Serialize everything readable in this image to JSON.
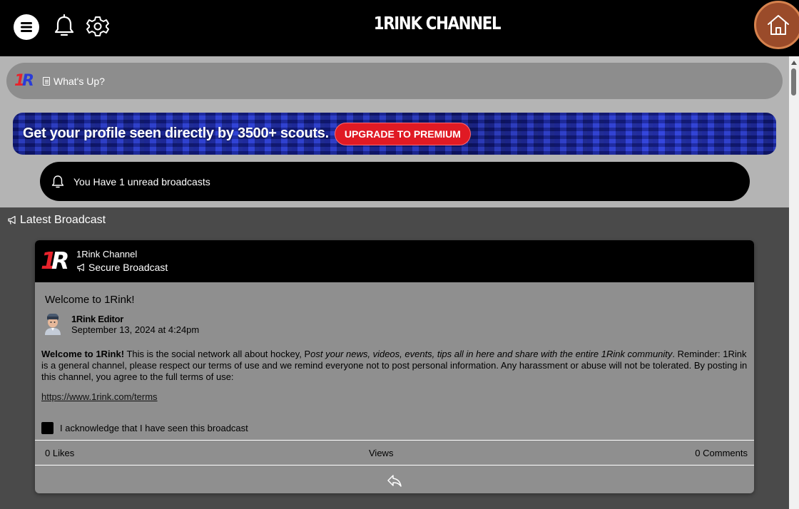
{
  "header": {
    "title": "1RINK CHANNEL",
    "menu_icon": "menu-icon",
    "bell_icon": "bell-icon",
    "settings_icon": "gear-icon",
    "home_icon": "home-icon"
  },
  "composer": {
    "logo_text_1": "1",
    "logo_text_2": "R",
    "placeholder": "What's Up?"
  },
  "promo": {
    "text": "Get your profile seen directly by 3500+ scouts.",
    "button_label": "UPGRADE TO PREMIUM"
  },
  "unread": {
    "text": "You Have 1 unread broadcasts"
  },
  "latest": {
    "heading": "Latest Broadcast"
  },
  "broadcast": {
    "logo_1": "1",
    "logo_2": "R",
    "channel_name": "1Rink Channel",
    "type_label": "Secure Broadcast",
    "title": "Welcome to 1Rink!",
    "author": "1Rink Editor",
    "date": "September 13, 2024 at 4:24pm",
    "body_bold": "Welcome to 1Rink!",
    "body_plain_1": " This is the social network all about hockey, P",
    "body_italic": "ost your news, videos, events, tips all in here and share with the entire 1Rink community",
    "body_plain_2": ". Reminder: 1Rink is a general channel, please respect our terms of use and we remind everyone not to post personal information. Any harassment or abuse will not be tolerated. By posting in this channel, you agree to the full terms of use:",
    "link": "https://www.1rink.com/terms",
    "acknowledge_label": "I acknowledge that I have seen this broadcast",
    "likes": "0 Likes",
    "views": "Views",
    "comments": "0 Comments"
  },
  "colors": {
    "header_bg": "#000000",
    "accent_red": "#e01a24",
    "home_button": "#9a4b2a",
    "card_bg": "#8f8f8f",
    "page_bg": "#4a4a4a"
  }
}
